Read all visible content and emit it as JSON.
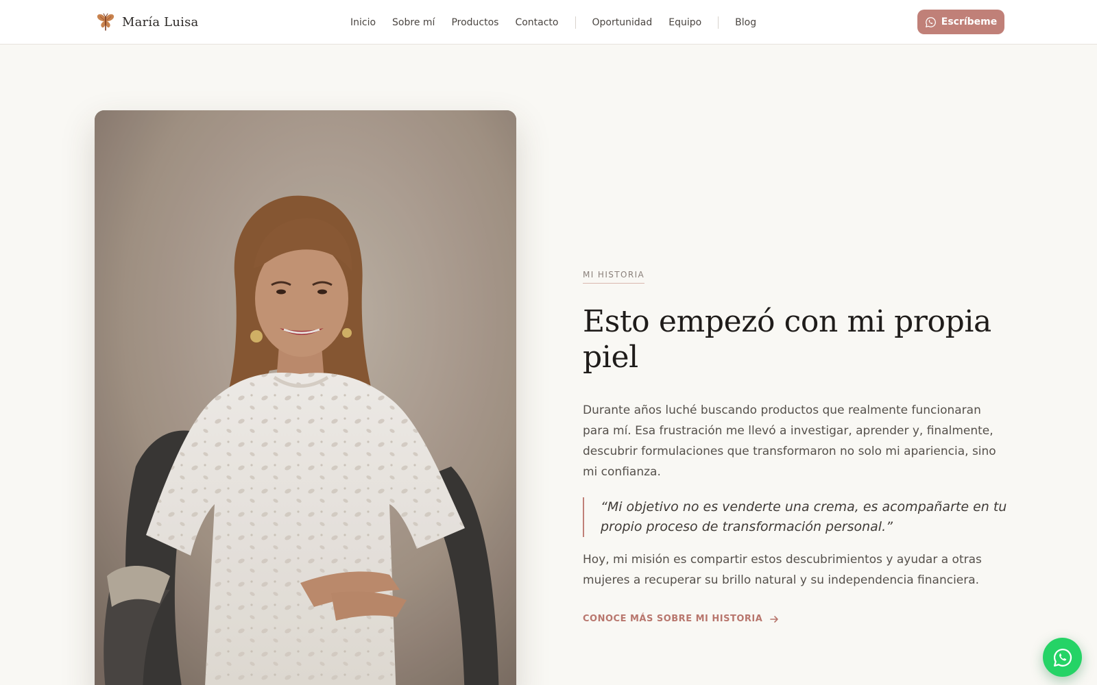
{
  "header": {
    "brand_name": "María Luisa",
    "logo_icon": "butterfly-logo-icon",
    "nav": [
      {
        "label": "Inicio"
      },
      {
        "label": "Sobre mí"
      },
      {
        "label": "Productos"
      },
      {
        "label": "Contacto"
      },
      {
        "label": "Oportunidad"
      },
      {
        "label": "Equipo"
      },
      {
        "label": "Blog"
      }
    ],
    "cta": {
      "label": "Escríbeme",
      "icon": "whatsapp-icon"
    }
  },
  "story": {
    "eyebrow": "MI HISTORIA",
    "headline": "Esto empezó con mi propia piel",
    "paragraph_1": "Durante años luché buscando productos que realmente funcionaran para mí. Esa frustración me llevó a investigar, aprender y, finalmente, descubrir formulaciones que transformaron no solo mi apariencia, sino mi confianza.",
    "quote": "“Mi objetivo no es venderte una crema, es acompañarte en tu propio proceso de transformación personal.”",
    "paragraph_2": "Hoy, mi misión es compartir estos descubrimientos y ayudar a otras mujeres a recuperar su brillo natural y su independencia financiera.",
    "link_label": "CONOCE MÁS SOBRE MI HISTORIA",
    "link_icon": "arrow-right-icon"
  },
  "floating_button": {
    "icon": "whatsapp-icon"
  },
  "colors": {
    "accent": "#c08078",
    "accent_text": "#b8766d",
    "background": "#f9f8f4",
    "header_bg": "#ffffff",
    "whatsapp": "#25d366"
  }
}
